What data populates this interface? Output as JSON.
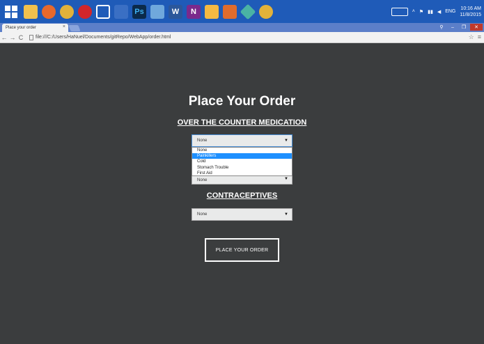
{
  "browser": {
    "tab_title": "Place your order",
    "tab_close": "×",
    "url": "file:///C:/Users/HaNuel/Documents/gitRepo/WebApp/order.html"
  },
  "taskbar": {
    "icons": [
      "file-explorer-icon",
      "firefox-icon",
      "chrome-icon",
      "opera-icon",
      "app-icon",
      "vmware-icon",
      "photoshop-icon",
      "chat-icon",
      "word-icon",
      "onenote-icon",
      "folder-icon",
      "grid-app-icon",
      "git-icon",
      "chrome-alt-icon"
    ],
    "photoshop_label": "Ps",
    "word_label": "W",
    "onenote_label": "N",
    "lang": "ENG",
    "time": "10:16 AM",
    "date": "11/8/2015"
  },
  "page": {
    "title": "Place Your Order",
    "otc_heading": "OVER THE COUNTER MEDICATION",
    "contraceptives_heading": "CONTRACEPTIVES",
    "select1_value": "None",
    "select2_value": "None",
    "select3_value": "None",
    "dropdown_options": [
      "None",
      "Painkillers",
      "Cold",
      "Stomach Trouble",
      "First Aid"
    ],
    "dropdown_highlighted": "Painkillers",
    "order_button": "PLACE YOUR ORDER"
  },
  "colors": {
    "background": "#3b3d3e",
    "taskbar": "#1f5bb8",
    "highlight": "#1e90ff"
  }
}
